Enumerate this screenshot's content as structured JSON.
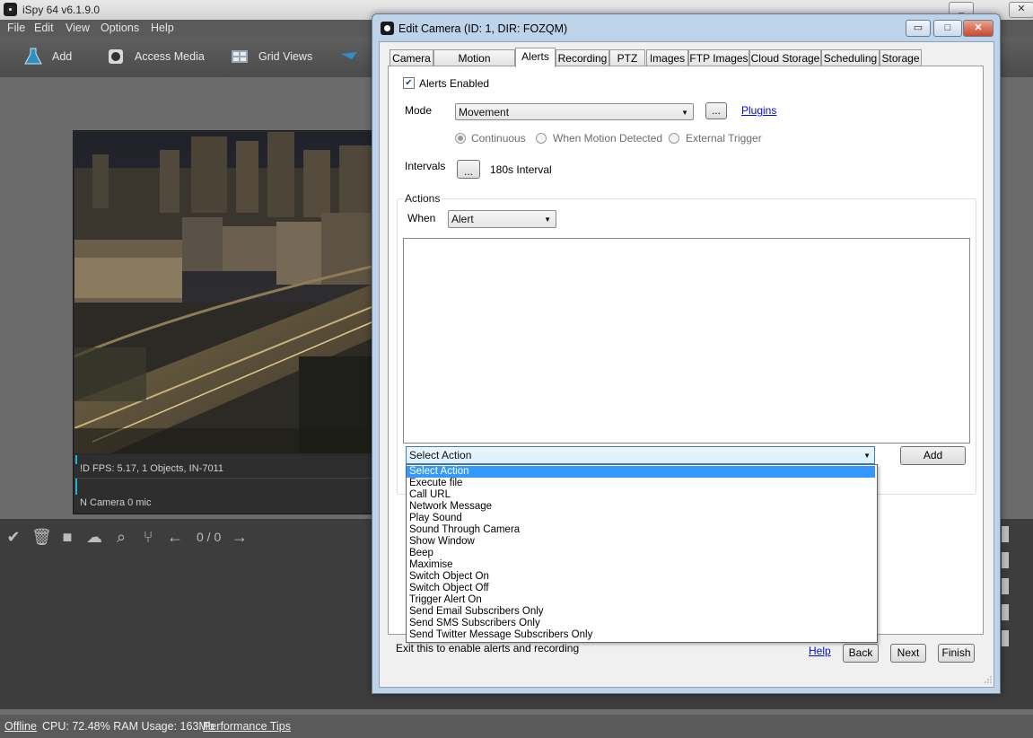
{
  "main_window": {
    "title": "iSpy 64 v6.1.9.0",
    "menu": [
      "File",
      "Edit",
      "View",
      "Options",
      "Help"
    ],
    "toolbar": {
      "add_label": "Add",
      "access_media_label": "Access Media",
      "grid_views_label": "Grid Views"
    },
    "camera_tile": {
      "info": "!D  FPS: 5.17, 1 Objects, IN-7011",
      "mic": "N  Camera 0 mic"
    },
    "counter": "0 / 0",
    "status": {
      "offline": "Offline",
      "cpu_ram": "CPU: 72.48% RAM Usage: 163Mb",
      "performance_tips": "Performance Tips"
    }
  },
  "dialog": {
    "title": "Edit Camera (ID: 1, DIR: FOZQM)",
    "tabs": [
      "Camera",
      "Motion Detection",
      "Alerts",
      "Recording",
      "PTZ",
      "Images",
      "FTP Images",
      "Cloud Storage",
      "Scheduling",
      "Storage"
    ],
    "active_tab": "Alerts",
    "alerts_enabled_label": "Alerts Enabled",
    "alerts_enabled": true,
    "mode_label": "Mode",
    "mode_value": "Movement",
    "ellipsis": "...",
    "plugins_link": "Plugins",
    "radio_continuous": "Continuous",
    "radio_motion": "When Motion Detected",
    "radio_external": "External Trigger",
    "selected_radio": "Continuous",
    "intervals_label": "Intervals",
    "interval_value": "180s Interval",
    "actions_label": "Actions",
    "when_label": "When",
    "when_value": "Alert",
    "select_action_value": "Select Action",
    "action_options": [
      "Select Action",
      "Execute file",
      "Call URL",
      "Network Message",
      "Play Sound",
      "Sound Through Camera",
      "Show Window",
      "Beep",
      "Maximise",
      "Switch Object On",
      "Switch Object Off",
      "Trigger Alert On",
      "Send Email Subscribers Only",
      "Send SMS Subscribers Only",
      "Send Twitter Message Subscribers Only"
    ],
    "add_button": "Add",
    "footer_note": "Exit this to enable alerts and recording",
    "help_link": "Help",
    "back_button": "Back",
    "next_button": "Next",
    "finish_button": "Finish"
  },
  "colors": {
    "accent_selection": "#3399ff",
    "link": "#0010d8",
    "dialog_frame": "#bcd3ea",
    "app_background": "#6b6b6b"
  }
}
